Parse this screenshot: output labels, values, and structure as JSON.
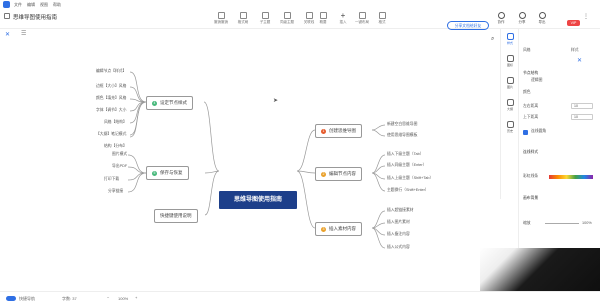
{
  "menubar": {
    "items": [
      "文件",
      "编辑",
      "视图",
      "帮助"
    ]
  },
  "header": {
    "doc_title": "思维导图使用指南"
  },
  "toolbar": [
    {
      "label": "撤销撤销",
      "icon": "undo-icon"
    },
    {
      "label": "格式刷",
      "icon": "format-brush-icon"
    },
    {
      "label": "子主题",
      "icon": "subtopic-icon"
    },
    {
      "label": "同级主题",
      "icon": "sibling-topic-icon"
    },
    {
      "label": "关联线",
      "icon": "relation-icon"
    },
    {
      "label": "概要",
      "icon": "summary-icon"
    },
    {
      "label": "插入",
      "icon": "plus-icon"
    },
    {
      "label": "一键布局",
      "icon": "layout-icon"
    },
    {
      "label": "格式",
      "icon": "format-icon"
    }
  ],
  "share_button": "分享文档给好友",
  "right_toolbar": [
    {
      "label": "协作",
      "icon": "collab-icon"
    },
    {
      "label": "分享",
      "icon": "share-icon"
    },
    {
      "label": "导出",
      "icon": "export-icon"
    }
  ],
  "vip_badge": "VIP",
  "mindmap": {
    "root": "思维导图使用指南",
    "branches": [
      {
        "num": "1",
        "label": "创建思维导图",
        "color": "#e55a2b",
        "children": [
          "新建空白思维导图",
          "使用思维导图模板"
        ]
      },
      {
        "num": "2",
        "label": "编辑节点内容",
        "color": "#e9a02a",
        "children": [
          "插入下级主题（Tab）",
          "插入同级主题（Enter）",
          "插入上级主题（Shift+Tab）",
          "主题换行（Shift+Enter）"
        ]
      },
      {
        "num": "3",
        "label": "插入素材内容",
        "color": "#e9a02a",
        "children": [
          "插入超链接素材",
          "插入图片素材",
          "插入备注内容",
          "插入公式内容"
        ]
      },
      {
        "num": "4",
        "label": "设定节点样式",
        "color": "#45b87a",
        "children": [
          "编辑节点【样式】",
          "边框【大小】风格",
          "颜色【填充】风格",
          "字体【调节】大小",
          "风格【结构】",
          "【大纲】笔记模式",
          "结构【分布】"
        ]
      },
      {
        "num": "5",
        "label": "保存与恢复",
        "color": "#45b87a",
        "children": [
          "图片模式",
          "导出PDF",
          "打印下载",
          "分享链接"
        ]
      },
      {
        "num": "",
        "label": "快捷键使用说明",
        "color": "",
        "children": []
      }
    ]
  },
  "sidebar": [
    {
      "label": "样式",
      "icon": "style-icon",
      "active": true
    },
    {
      "label": "图标",
      "icon": "emoji-icon",
      "active": false
    },
    {
      "label": "图片",
      "icon": "image-icon",
      "active": false
    },
    {
      "label": "大纲",
      "icon": "outline-icon",
      "active": false
    },
    {
      "label": "历史",
      "icon": "history-icon",
      "active": false
    }
  ],
  "panel": {
    "tabs": [
      "风格",
      "样式"
    ],
    "section1": "节点结构",
    "structure": "逻辑图",
    "color_label": "颜色",
    "spacing_h": "10",
    "spacing_v": "10",
    "spacing_h_label": "左右距离",
    "spacing_v_label": "上下距离",
    "checkbox_label": "连线圆角",
    "section2": "连线样式",
    "section3": "画布背景",
    "rainbow_label": "彩虹线条",
    "zoom_label": "缩放",
    "zoom_value": "100%"
  },
  "statusbar": {
    "left": "快捷导航",
    "count": "字数: 37",
    "zoom": "100%"
  }
}
